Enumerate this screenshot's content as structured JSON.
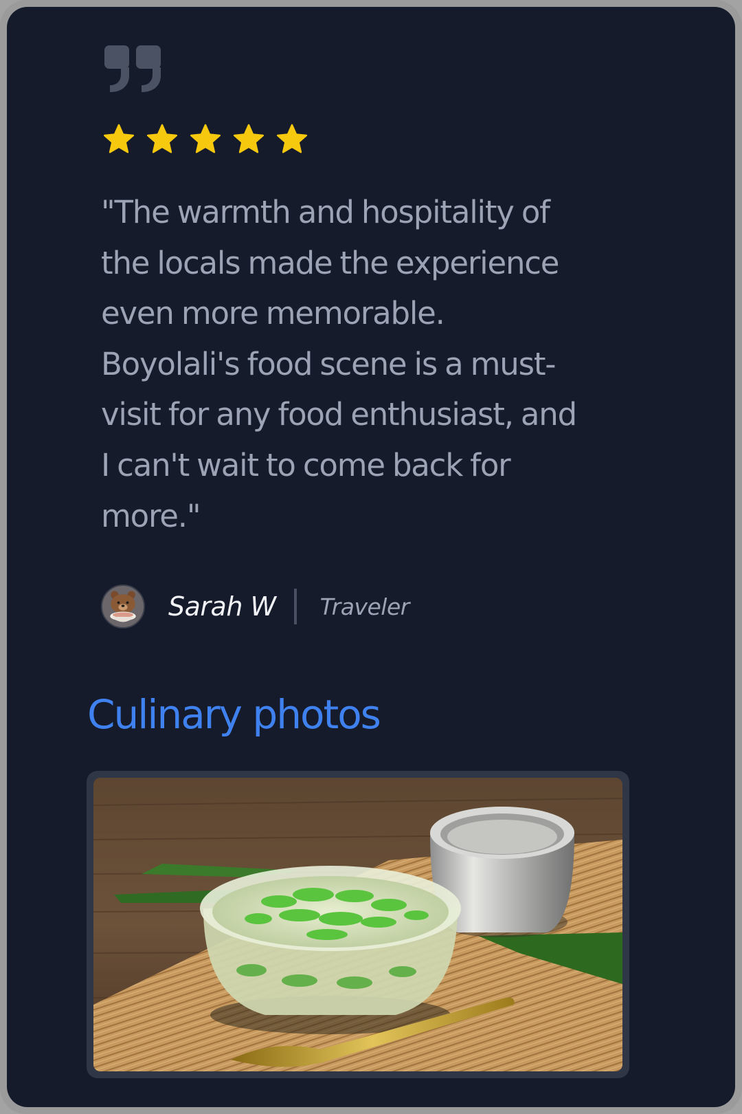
{
  "review": {
    "quote_icon": "quote-icon",
    "rating": 5,
    "rating_max": 5,
    "star_color": "#f6c90e",
    "text": "\"The warmth and hospitality of the locals made the experience even more memorable. Boyolali's food scene is a must-visit for any food enthusiast, and I can't wait to come back for more.\""
  },
  "author": {
    "avatar_icon": "bear-avatar",
    "name": "Sarah W",
    "role": "Traveler"
  },
  "gallery": {
    "title": "Culinary photos",
    "title_color": "#3f82ef"
  },
  "colors": {
    "background": "#151b2b",
    "frame": "#9b9b9b",
    "text_muted": "#9ca3b5"
  }
}
